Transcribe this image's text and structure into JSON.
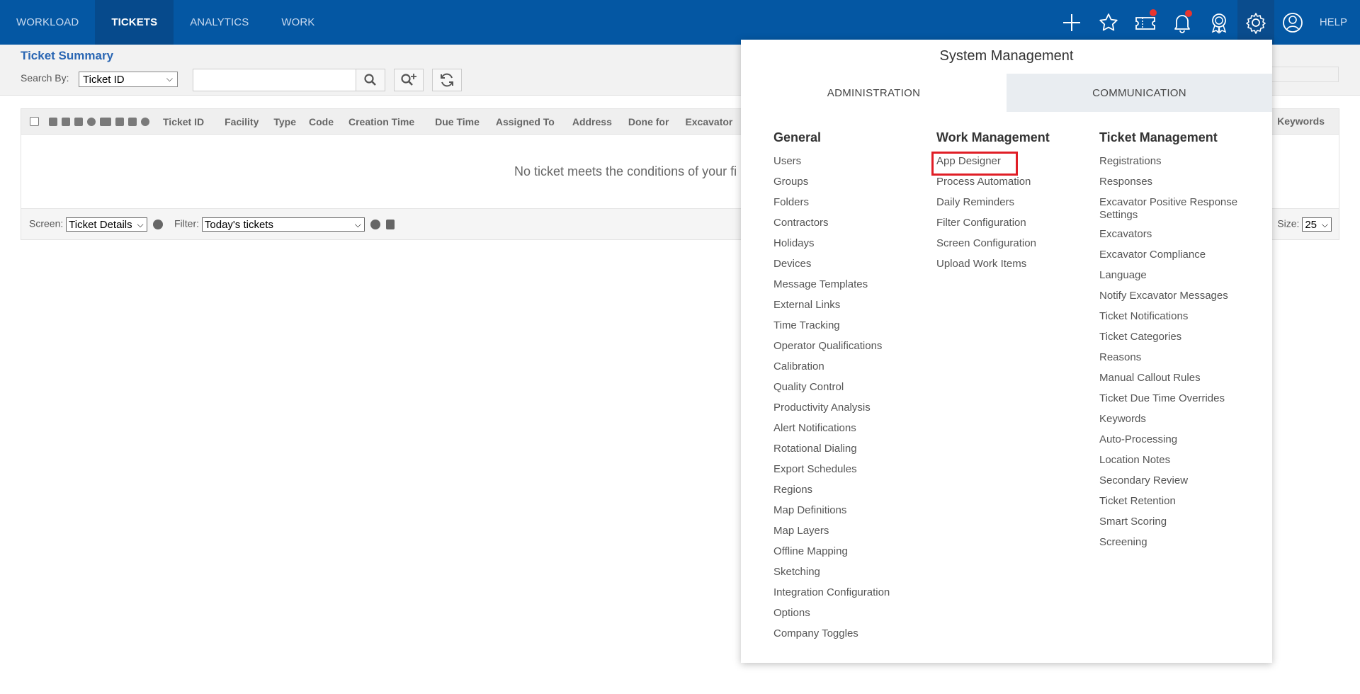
{
  "nav": {
    "tabs": [
      "WORKLOAD",
      "TICKETS",
      "ANALYTICS",
      "WORK"
    ],
    "active_tab": "TICKETS",
    "help_label": "HELP",
    "icons": [
      "plus-icon",
      "star-icon",
      "ticket-icon",
      "bell-icon",
      "award-icon",
      "gear-icon",
      "user-icon"
    ],
    "brand_color": "#0457a3",
    "notification_color": "#e8352f"
  },
  "page": {
    "title": "Ticket Summary",
    "search_by_label": "Search By:",
    "search_by_value": "Ticket ID",
    "search_value": ""
  },
  "grid": {
    "columns": [
      "Ticket ID",
      "Facility",
      "Type",
      "Code",
      "Creation Time",
      "Due Time",
      "Assigned To",
      "Address",
      "Done for",
      "Excavator"
    ],
    "last_column": "Keywords",
    "empty_message": "No ticket meets the conditions of your fi",
    "screen_label": "Screen:",
    "screen_value": "Ticket Details",
    "filter_label": "Filter:",
    "filter_value": "Today's tickets",
    "page_size_label": "Size:",
    "page_size_value": "25"
  },
  "system_menu": {
    "title": "System Management",
    "tabs": [
      "ADMINISTRATION",
      "COMMUNICATION"
    ],
    "active_tab": "ADMINISTRATION",
    "columns": [
      {
        "heading": "General",
        "items": [
          "Users",
          "Groups",
          "Folders",
          "Contractors",
          "Holidays",
          "Devices",
          "Message Templates",
          "External Links",
          "Time Tracking",
          "Operator Qualifications",
          "Calibration",
          "Quality Control",
          "Productivity Analysis",
          "Alert Notifications",
          "Rotational Dialing",
          "Export Schedules",
          "Regions",
          "Map Definitions",
          "Map Layers",
          "Offline Mapping",
          "Sketching",
          "Integration Configuration",
          "Options",
          "Company Toggles"
        ]
      },
      {
        "heading": "Work Management",
        "items": [
          "App Designer",
          "Process Automation",
          "Daily Reminders",
          "Filter Configuration",
          "Screen Configuration",
          "Upload Work Items"
        ]
      },
      {
        "heading": "Ticket Management",
        "items": [
          "Registrations",
          "Responses",
          "Excavator Positive Response Settings",
          "Excavators",
          "Excavator Compliance",
          "Language",
          "Notify Excavator Messages",
          "Ticket Notifications",
          "Ticket Categories",
          "Reasons",
          "Manual Callout Rules",
          "Ticket Due Time Overrides",
          "Keywords",
          "Auto-Processing",
          "Location Notes",
          "Secondary Review",
          "Ticket Retention",
          "Smart Scoring",
          "Screening"
        ]
      }
    ],
    "highlighted_item": "App Designer",
    "highlight_color": "#e01e26"
  }
}
